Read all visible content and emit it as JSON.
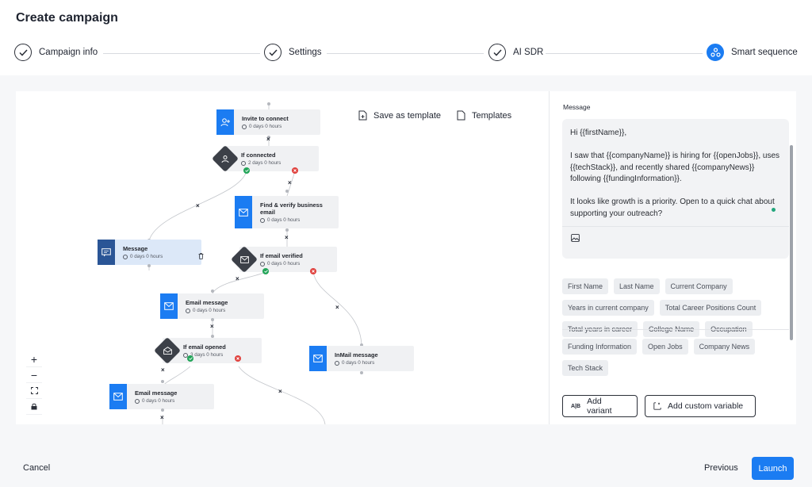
{
  "page": {
    "title": "Create campaign"
  },
  "stepper": {
    "steps": [
      {
        "label": "Campaign info"
      },
      {
        "label": "Settings"
      },
      {
        "label": "AI SDR"
      },
      {
        "label": "Smart sequence"
      }
    ]
  },
  "canvas": {
    "save_template_label": "Save as template",
    "templates_label": "Templates",
    "nodes": {
      "invite": {
        "title": "Invite to connect",
        "sub": "0 days 0 hours"
      },
      "if_connected": {
        "title": "If connected",
        "sub": "2 days 0 hours"
      },
      "find_email": {
        "title": "Find & verify business email",
        "sub": "0 days 0 hours"
      },
      "message": {
        "title": "Message",
        "sub": "0 days 0 hours"
      },
      "if_email_verified": {
        "title": "If email verified",
        "sub": "0 days 0 hours"
      },
      "email_message_1": {
        "title": "Email message",
        "sub": "0 days 0 hours"
      },
      "if_email_opened": {
        "title": "If email opened",
        "sub": "3 days 0 hours"
      },
      "inmail": {
        "title": "InMail message",
        "sub": "0 days 0 hours"
      },
      "email_message_2": {
        "title": "Email message",
        "sub": "0 days 0 hours"
      }
    },
    "zoom": {
      "in": "+",
      "out": "−"
    }
  },
  "panel": {
    "message_label": "Message",
    "message_paragraphs": [
      "Hi {{firstName}},",
      "I saw that {{companyName}} is hiring for {{openJobs}}, uses {{techStack}}, and recently shared {{companyNews}} following {{fundingInformation}}.",
      "It looks like growth is a priority. Open to a quick chat about supporting your outreach?"
    ],
    "variables": [
      "First Name",
      "Last Name",
      "Current Company",
      "Years in current company",
      "Total Career Positions Count",
      "Total years in career",
      "College Name",
      "Occupation"
    ],
    "variables_extra": [
      "Funding Information",
      "Open Jobs",
      "Company News",
      "Tech Stack"
    ],
    "add_variant_label": "Add variant",
    "add_custom_variable_label": "Add custom variable"
  },
  "footer": {
    "cancel": "Cancel",
    "previous": "Previous",
    "launch": "Launch"
  },
  "colors": {
    "accent": "#1b7cf2",
    "success": "#23a559",
    "danger": "#e0413d"
  }
}
